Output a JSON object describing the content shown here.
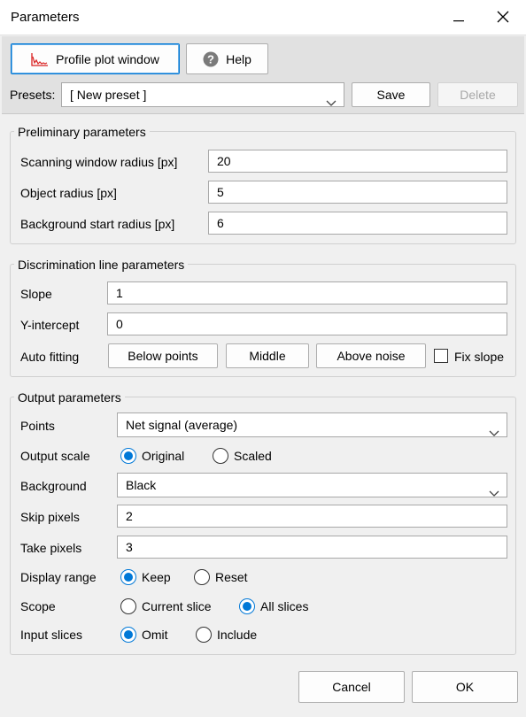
{
  "window": {
    "title": "Parameters",
    "minimize_icon": "minimize-icon",
    "close_icon": "close-icon"
  },
  "toolbar": {
    "profile_plot_label": "Profile plot window",
    "help_label": "Help",
    "presets_label": "Presets:",
    "preset_value": "[ New preset ]",
    "save_label": "Save",
    "delete_label": "Delete"
  },
  "preliminary": {
    "title": "Preliminary parameters",
    "scanning_label": "Scanning window radius [px]",
    "scanning_value": "20",
    "object_label": "Object radius [px]",
    "object_value": "5",
    "background_label": "Background start radius [px]",
    "background_value": "6"
  },
  "discrimination": {
    "title": "Discrimination line parameters",
    "slope_label": "Slope",
    "slope_value": "1",
    "yint_label": "Y-intercept",
    "yint_value": "0",
    "autofit_label": "Auto fitting",
    "below_label": "Below points",
    "middle_label": "Middle",
    "above_label": "Above noise",
    "fixslope_label": "Fix slope",
    "fixslope_checked": false
  },
  "output": {
    "title": "Output parameters",
    "points_label": "Points",
    "points_value": "Net signal (average)",
    "scale_label": "Output scale",
    "scale_options": [
      "Original",
      "Scaled"
    ],
    "scale_selected": "Original",
    "background_label": "Background",
    "background_value": "Black",
    "skip_label": "Skip pixels",
    "skip_value": "2",
    "take_label": "Take pixels",
    "take_value": "3",
    "range_label": "Display range",
    "range_options": [
      "Keep",
      "Reset"
    ],
    "range_selected": "Keep",
    "scope_label": "Scope",
    "scope_options": [
      "Current slice",
      "All slices"
    ],
    "scope_selected": "All slices",
    "input_label": "Input slices",
    "input_options": [
      "Omit",
      "Include"
    ],
    "input_selected": "Omit"
  },
  "footer": {
    "cancel_label": "Cancel",
    "ok_label": "OK"
  },
  "colors": {
    "accent": "#0078d7",
    "plot_icon": "#d92020",
    "help_icon": "#7a7a7a"
  }
}
